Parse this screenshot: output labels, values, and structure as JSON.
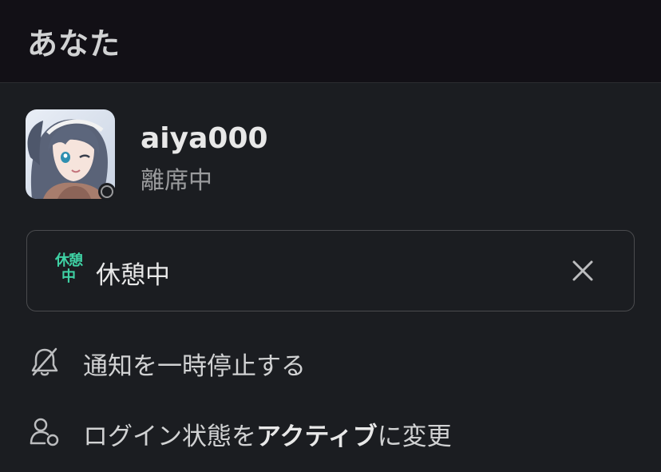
{
  "header": {
    "title": "あなた"
  },
  "profile": {
    "username": "aiya000",
    "presence": "離席中",
    "avatar_icon": "anime-avatar-image",
    "presence_icon": "away-presence-icon"
  },
  "status": {
    "emoji_line1": "休憩",
    "emoji_line2": "中",
    "text": "休憩中",
    "emoji_color": "#3fd1a4",
    "clear_icon": "close-icon"
  },
  "menu": {
    "pause_notifications": {
      "label": "通知を一時停止する",
      "icon": "bell-off-icon"
    },
    "set_active": {
      "label_prefix": "ログイン状態を",
      "label_bold": "アクティブ",
      "label_suffix": "に変更",
      "icon": "user-status-icon"
    }
  },
  "colors": {
    "background": "#1b1d21",
    "header_background": "#121016",
    "text": "#d1d2d3",
    "muted": "#9a9b9d",
    "border": "#4a4b4e"
  }
}
